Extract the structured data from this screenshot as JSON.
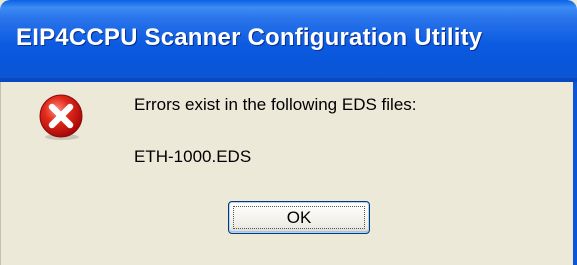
{
  "dialog": {
    "title": "EIP4CCPU Scanner Configuration Utility",
    "icon": "error-icon",
    "message_line_1": "Errors exist in the following EDS files:",
    "message_line_2": "ETH-1000.EDS",
    "ok_label": "OK"
  },
  "colors": {
    "titlebar": "#0a55d8",
    "dialog_background": "#ece9d8",
    "error_red": "#d01010"
  }
}
